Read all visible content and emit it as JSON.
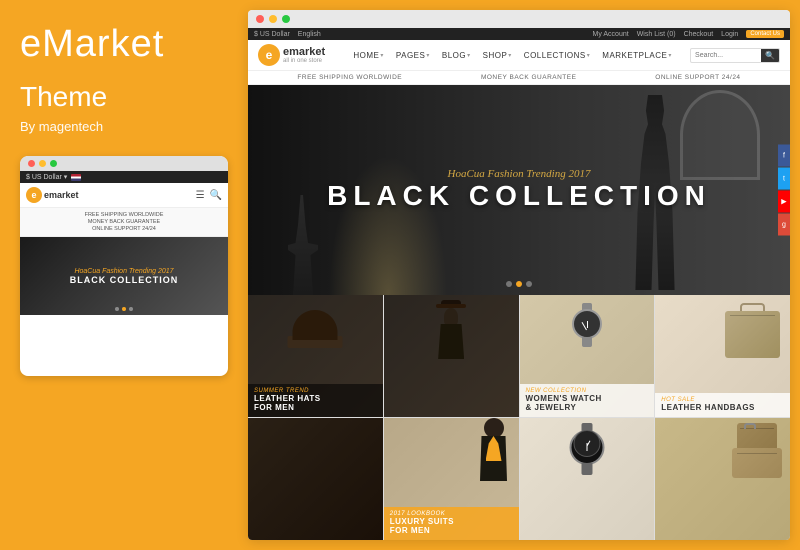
{
  "left": {
    "brand": "eMarket",
    "theme_label": "Theme",
    "by_label": "By magentech"
  },
  "mobile": {
    "logo": "emarket",
    "logo_subtitle": "all in one store",
    "shipping_lines": [
      "FREE SHIPPING WORLDWIDE",
      "MONEY BACK GUARANTEE",
      "ONLINE SUPPORT 24/24"
    ],
    "hero_cursive": "HoaCua Fashion Trending 2017",
    "hero_main": "BLACK COLLECTION"
  },
  "desktop": {
    "topbar": {
      "currency": "$ US Dollar",
      "language": "English",
      "my_account": "My Account",
      "wishlist": "Wish List (0)",
      "checkout": "Checkout",
      "login": "Login",
      "badge": "Contact Us"
    },
    "nav": {
      "logo_name": "emarket",
      "logo_sub": "all in one store",
      "links": [
        {
          "label": "HOME"
        },
        {
          "label": "PAGES"
        },
        {
          "label": "BLOG"
        },
        {
          "label": "SHOP"
        },
        {
          "label": "COLLECTIONS"
        },
        {
          "label": "MARKETPLACE"
        }
      ],
      "search_placeholder": "Search..."
    },
    "shipping": {
      "items": [
        "FREE SHIPPING WORLDWIDE",
        "MONEY BACK GUARANTEE",
        "ONLINE SUPPORT 24/24"
      ]
    },
    "hero": {
      "cursive": "HoaCua Fashion Trending 2017",
      "main": "BLACK COLLECTION"
    },
    "products": [
      {
        "subtitle": "Summer Trend",
        "title": "LEATHER HATS\nFOR MEN",
        "style": "cell-1"
      },
      {
        "subtitle": "",
        "title": "",
        "style": "cell-3"
      },
      {
        "subtitle": "",
        "title": "",
        "style": "cell-4"
      },
      {
        "subtitle": "New Collection",
        "title": "WOMEN'S WATCH\n& JEWELRY",
        "style": "cell-5"
      },
      {
        "subtitle": "2017 Lookbook",
        "title": "LUXURY SUITS\nFOR MEN",
        "style": "cell-7"
      },
      {
        "subtitle": "Hot Sale",
        "title": "LEATHER HANDBAGS",
        "style": "cell-8"
      }
    ]
  },
  "icons": {
    "search": "🔍",
    "menu": "☰",
    "cart": "🛒",
    "user": "👤",
    "heart": "♥",
    "facebook": "f",
    "twitter": "t",
    "youtube": "▶",
    "google": "g+"
  }
}
